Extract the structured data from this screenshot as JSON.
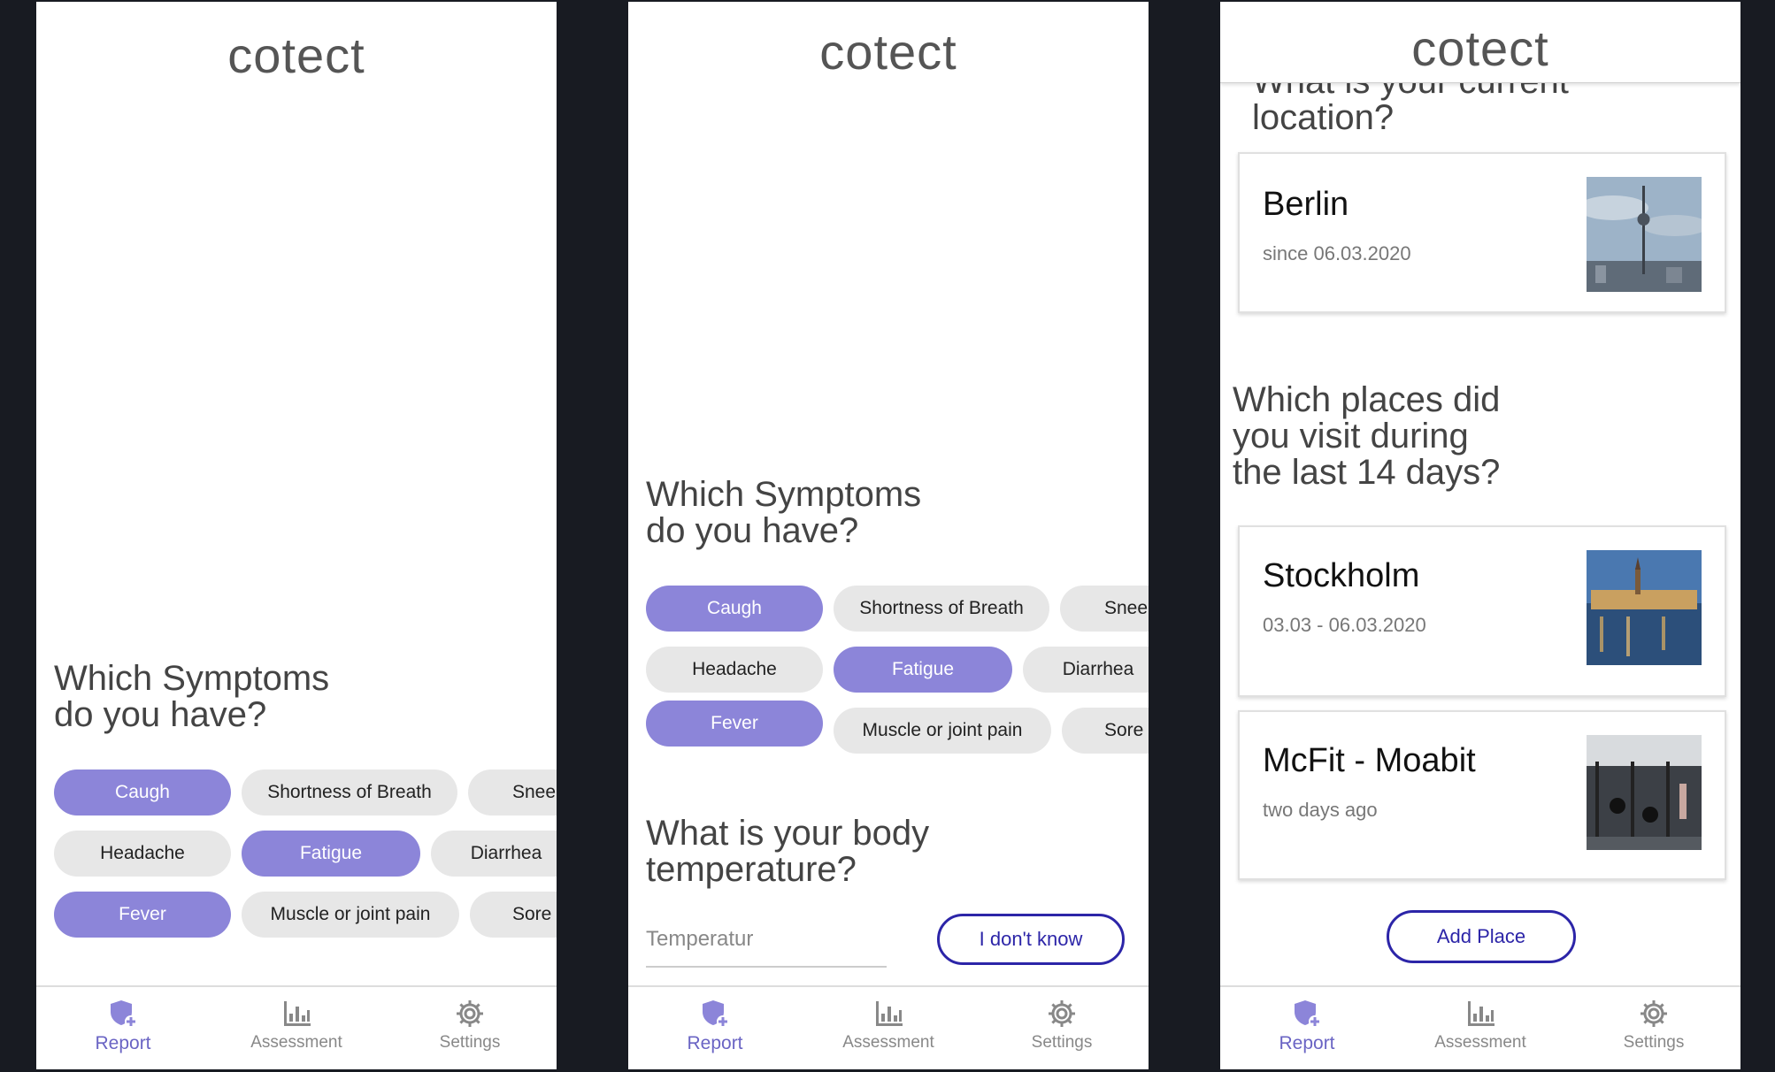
{
  "app": {
    "brand": "cotect"
  },
  "nav": {
    "report": "Report",
    "assessment": "Assessment",
    "settings": "Settings"
  },
  "symptoms": {
    "question": "Which Symptoms\ndo you have?",
    "chips": [
      "Caugh",
      "Shortness of Breath",
      "Snee",
      "Headache",
      "Fatigue",
      "Diarrhea",
      "Fever",
      "Muscle or joint pain",
      "Sore T"
    ],
    "selected": [
      "Caugh",
      "Fatigue",
      "Fever"
    ]
  },
  "temperature": {
    "question": "What is your body\ntemperature?",
    "placeholder": "Temperatur",
    "dont_know": "I don't know"
  },
  "location": {
    "question_partial": "What is your current\nlocation?",
    "current": {
      "title": "Berlin",
      "subtitle": "since 06.03.2020"
    }
  },
  "places": {
    "question": "Which places did\nyou visit during\nthe last 14 days?",
    "items": [
      {
        "title": "Stockholm",
        "subtitle": "03.03 - 06.03.2020"
      },
      {
        "title": "McFit - Moabit",
        "subtitle": "two days ago"
      }
    ],
    "add_label": "Add Place"
  },
  "colors": {
    "accent": "#8c85d9",
    "nav_active": "#6a64c4",
    "button_outline": "#2c25a8",
    "background": "#181b22"
  },
  "icons": [
    "shield-plus-icon",
    "bar-chart-icon",
    "gear-icon"
  ]
}
